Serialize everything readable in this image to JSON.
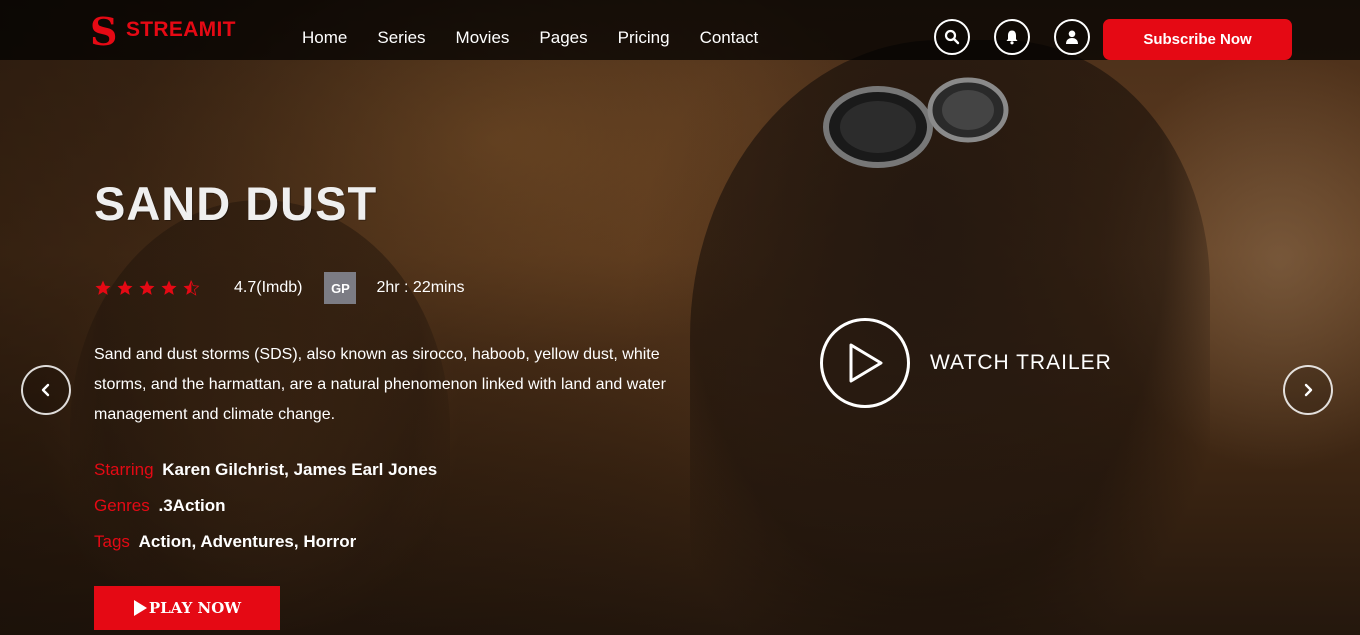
{
  "brand": {
    "logo_letter": "S",
    "name": "STREAMIT",
    "accent_color": "#e50914"
  },
  "nav": {
    "items": [
      "Home",
      "Series",
      "Movies",
      "Pages",
      "Pricing",
      "Contact"
    ]
  },
  "header_icons": [
    "search-icon",
    "bell-icon",
    "user-icon"
  ],
  "subscribe_label": "Subscribe Now",
  "hero": {
    "title": "SAND DUST",
    "rating_stars": 4.5,
    "rating_max": 5,
    "rating_text": "4.7(Imdb)",
    "age_badge": "GP",
    "duration": "2hr : 22mins",
    "description": "Sand and dust storms (SDS), also known as sirocco, haboob, yellow dust, white storms, and the harmattan, are a natural phenomenon linked with land and water management and climate change.",
    "starring_label": "Starring",
    "starring_value": "Karen Gilchrist, James Earl Jones",
    "genres_label": "Genres",
    "genres_value": ".3Action",
    "tags_label": "Tags",
    "tags_value": "Action, Adventures, Horror",
    "play_label": "PLAY NOW",
    "trailer_label": "WATCH TRAILER"
  },
  "carousel": {
    "prev_icon": "chevron-left-icon",
    "next_icon": "chevron-right-icon"
  }
}
